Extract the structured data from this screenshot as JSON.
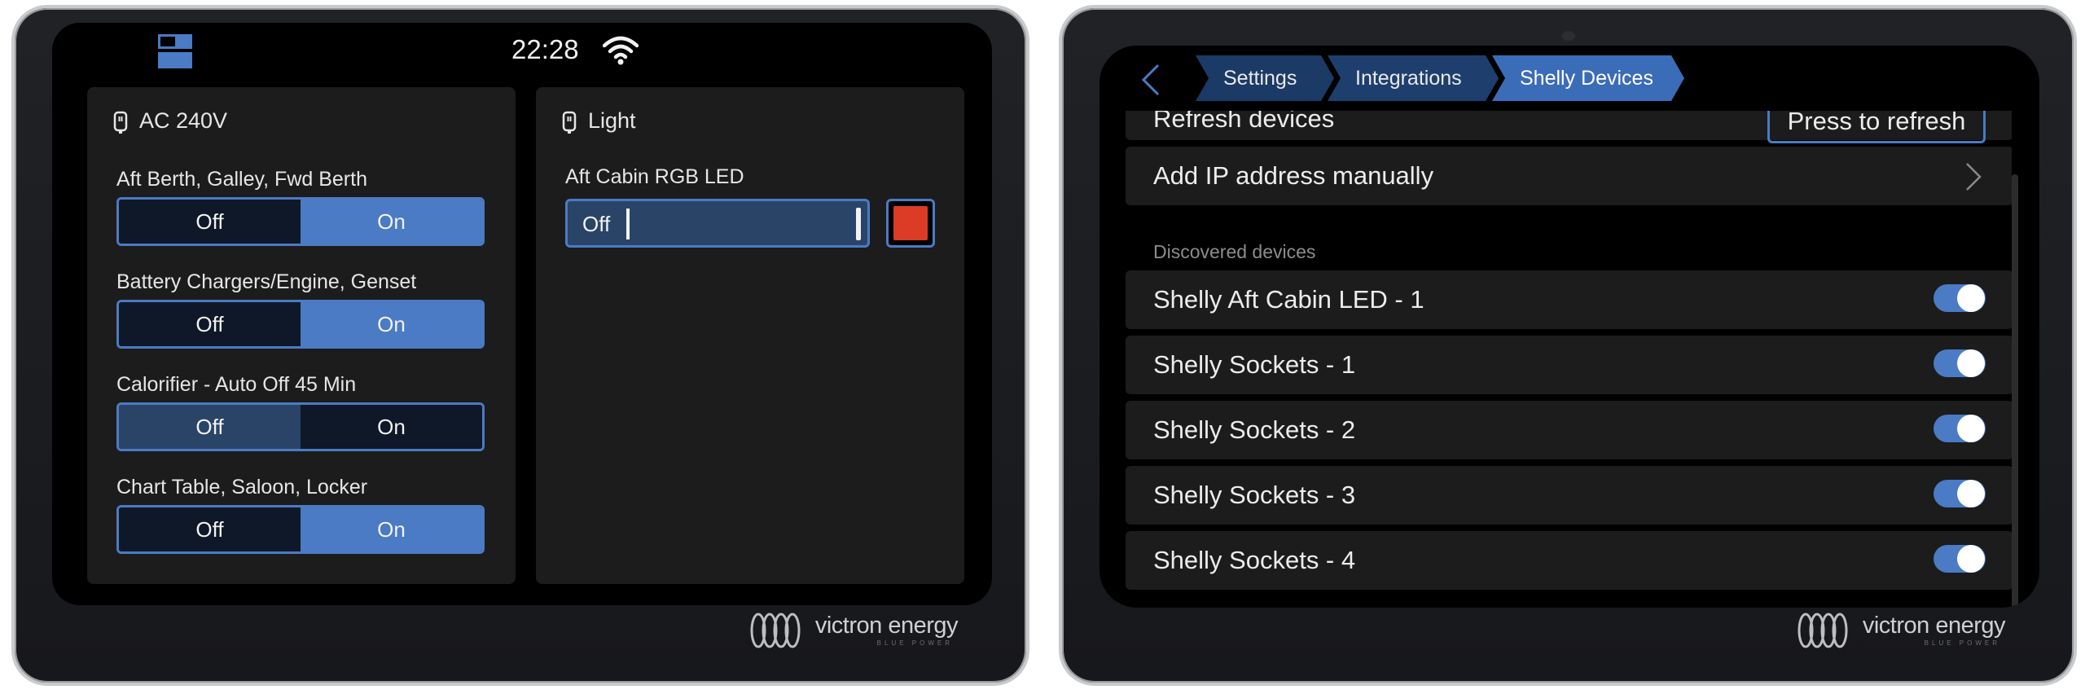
{
  "left_device": {
    "status": {
      "time": "22:28"
    },
    "panels": [
      {
        "title": "AC 240V",
        "switches": [
          {
            "label": "Aft Berth, Galley, Fwd Berth",
            "off": "Off",
            "on": "On",
            "state": "on"
          },
          {
            "label": "Battery Chargers/Engine, Genset",
            "off": "Off",
            "on": "On",
            "state": "on"
          },
          {
            "label": "Calorifier - Auto Off 45 Min",
            "off": "Off",
            "on": "On",
            "state": "off"
          },
          {
            "label": "Chart Table, Saloon, Locker",
            "off": "Off",
            "on": "On",
            "state": "on"
          }
        ]
      },
      {
        "title": "Light",
        "rgb": {
          "label": "Aft Cabin RGB LED",
          "value": "Off",
          "color": "#dc3b26"
        }
      }
    ],
    "brand": {
      "name": "victron energy",
      "tagline": "BLUE POWER"
    }
  },
  "right_device": {
    "breadcrumbs": [
      "Settings",
      "Integrations",
      "Shelly Devices"
    ],
    "refresh": {
      "label": "Refresh devices",
      "button": "Press to refresh"
    },
    "add_ip": {
      "label": "Add IP address manually"
    },
    "section": "Discovered devices",
    "devices": [
      {
        "name": "Shelly Aft Cabin LED - 1",
        "enabled": true
      },
      {
        "name": "Shelly Sockets - 1",
        "enabled": true
      },
      {
        "name": "Shelly Sockets - 2",
        "enabled": true
      },
      {
        "name": "Shelly Sockets - 3",
        "enabled": true
      },
      {
        "name": "Shelly Sockets - 4",
        "enabled": true
      }
    ],
    "brand": {
      "name": "victron energy",
      "tagline": "BLUE POWER"
    }
  },
  "colors": {
    "accent": "#4a7bc4",
    "panel": "#1c1c1c",
    "screen": "#000000",
    "rgb_swatch": "#dc3b26"
  },
  "icons": [
    "layout-toggle-icon",
    "wifi-icon",
    "plug-icon",
    "back-icon",
    "chevron-right-icon",
    "victron-logo-icon"
  ]
}
